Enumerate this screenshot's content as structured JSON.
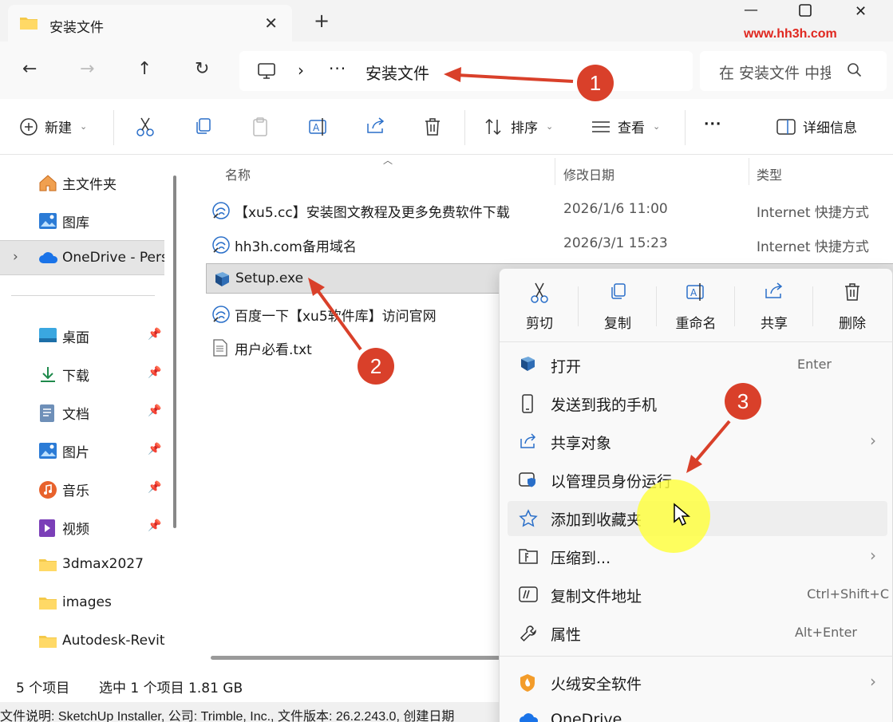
{
  "window": {
    "tab_title": "安装文件",
    "new_tab": "+",
    "minimize": "—",
    "close": "✕",
    "watermark": "www.hh3h.com"
  },
  "nav": {
    "path_more": "···",
    "path_current": "安装文件",
    "search_placeholder": "在 安装文件 中搜索"
  },
  "toolbar": {
    "new_label": "新建",
    "sort_label": "排序",
    "view_label": "查看",
    "more_label": "···",
    "details_label": "详细信息"
  },
  "sidebar": {
    "items": [
      {
        "label": "主文件夹",
        "icon": "home-icon"
      },
      {
        "label": "图库",
        "icon": "gallery-icon"
      },
      {
        "label": "OneDrive - Personal",
        "icon": "onedrive-icon"
      },
      {
        "label": "桌面",
        "icon": "desktop-icon"
      },
      {
        "label": "下载",
        "icon": "download-icon"
      },
      {
        "label": "文档",
        "icon": "document-icon"
      },
      {
        "label": "图片",
        "icon": "pictures-icon"
      },
      {
        "label": "音乐",
        "icon": "music-icon"
      },
      {
        "label": "视频",
        "icon": "video-icon"
      },
      {
        "label": "3dmax2027",
        "icon": "folder-icon"
      },
      {
        "label": "images",
        "icon": "folder-icon"
      },
      {
        "label": "Autodesk-Revit",
        "icon": "folder-icon"
      }
    ]
  },
  "filelist": {
    "columns": {
      "name": "名称",
      "modified": "修改日期",
      "type": "类型"
    },
    "rows": [
      {
        "name": "【xu5.cc】安装图文教程及更多免费软件下载",
        "modified": "2026/1/6 11:00",
        "type": "Internet 快捷方式"
      },
      {
        "name": "hh3h.com备用域名",
        "modified": "2026/3/1 15:23",
        "type": "Internet 快捷方式"
      },
      {
        "name": "Setup.exe",
        "modified": "",
        "type": ""
      },
      {
        "name": "百度一下【xu5软件库】访问官网",
        "modified": "",
        "type": ""
      },
      {
        "name": "用户必看.txt",
        "modified": "",
        "type": ""
      }
    ]
  },
  "status": {
    "count": "5 个项目",
    "selection": "选中 1 个项目  1.81 GB",
    "info": "文件说明: SketchUp Installer, 公司: Trimble, Inc., 文件版本: 26.2.243.0, 创建日期"
  },
  "context_menu": {
    "quick_actions": {
      "cut": "剪切",
      "copy": "复制",
      "rename": "重命名",
      "share": "共享",
      "delete": "删除"
    },
    "items": [
      {
        "label": "打开",
        "shortcut": "Enter"
      },
      {
        "label": "发送到我的手机",
        "shortcut": ""
      },
      {
        "label": "共享对象",
        "shortcut": ""
      },
      {
        "label": "以管理员身份运行",
        "shortcut": ""
      },
      {
        "label": "添加到收藏夹",
        "shortcut": ""
      },
      {
        "label": "压缩到...",
        "shortcut": ""
      },
      {
        "label": "复制文件地址",
        "shortcut": "Ctrl+Shift+C"
      },
      {
        "label": "属性",
        "shortcut": "Alt+Enter"
      },
      {
        "label": "火绒安全软件",
        "shortcut": ""
      },
      {
        "label": "OneDrive",
        "shortcut": ""
      }
    ]
  },
  "annotations": {
    "step1": "1",
    "step2": "2",
    "step3": "3"
  },
  "colors": {
    "annotation_red": "#d9402a",
    "highlight_yellow": "#ffff3c",
    "watermark_red": "#e0271f"
  }
}
